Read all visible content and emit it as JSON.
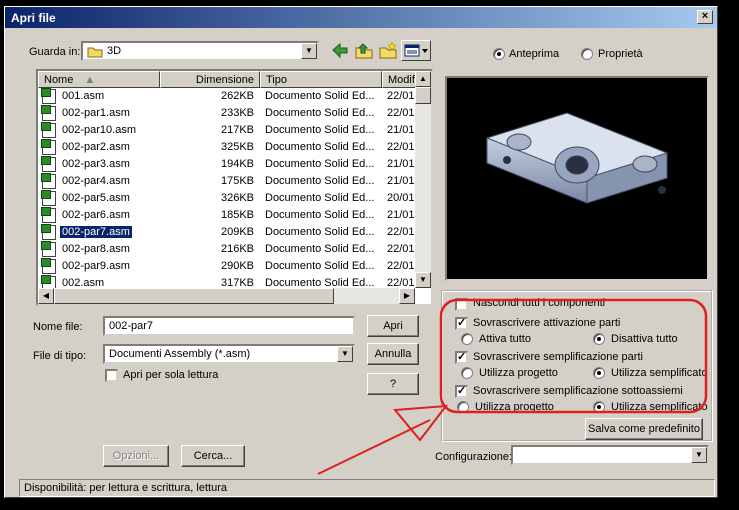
{
  "window": {
    "title": "Apri file",
    "close_glyph": "×"
  },
  "look_in": {
    "label": "Guarda in:",
    "value": "3D"
  },
  "columns": [
    "Nome",
    "Dimensione",
    "Tipo",
    "Modifi"
  ],
  "files": [
    {
      "name": "001.asm",
      "size": "262KB",
      "type": "Documento Solid Ed...",
      "date": "22/01"
    },
    {
      "name": "002-par1.asm",
      "size": "233KB",
      "type": "Documento Solid Ed...",
      "date": "22/01"
    },
    {
      "name": "002-par10.asm",
      "size": "217KB",
      "type": "Documento Solid Ed...",
      "date": "21/01"
    },
    {
      "name": "002-par2.asm",
      "size": "325KB",
      "type": "Documento Solid Ed...",
      "date": "22/01"
    },
    {
      "name": "002-par3.asm",
      "size": "194KB",
      "type": "Documento Solid Ed...",
      "date": "21/01"
    },
    {
      "name": "002-par4.asm",
      "size": "175KB",
      "type": "Documento Solid Ed...",
      "date": "21/01"
    },
    {
      "name": "002-par5.asm",
      "size": "326KB",
      "type": "Documento Solid Ed...",
      "date": "20/01"
    },
    {
      "name": "002-par6.asm",
      "size": "185KB",
      "type": "Documento Solid Ed...",
      "date": "21/01"
    },
    {
      "name": "002-par7.asm",
      "size": "209KB",
      "type": "Documento Solid Ed...",
      "date": "22/01",
      "selected": true
    },
    {
      "name": "002-par8.asm",
      "size": "216KB",
      "type": "Documento Solid Ed...",
      "date": "22/01"
    },
    {
      "name": "002-par9.asm",
      "size": "290KB",
      "type": "Documento Solid Ed...",
      "date": "22/01"
    },
    {
      "name": "002.asm",
      "size": "317KB",
      "type": "Documento Solid Ed...",
      "date": "22/01"
    }
  ],
  "filename": {
    "label": "Nome file:",
    "value": "002-par7"
  },
  "filetype": {
    "label": "File di tipo:",
    "value": "Documenti Assembly (*.asm)"
  },
  "readonly": {
    "label": "Apri per sola lettura",
    "checked": false
  },
  "buttons": {
    "open": "Apri",
    "cancel": "Annulla",
    "help": "?",
    "options": "Opzioni...",
    "search": "Cerca...",
    "save_default": "Salva come predefinito"
  },
  "view_mode": {
    "preview": "Anteprima",
    "properties": "Proprietà",
    "selected": "preview"
  },
  "options": {
    "hide_components": "Nascondi tutti i componenti",
    "activation": {
      "label": "Sovrascrivere attivazione parti",
      "checked": true,
      "opt_a": "Attiva tutto",
      "opt_b": "Disattiva tutto",
      "selected": "b"
    },
    "simplify_parts": {
      "label": "Sovrascrivere semplificazione parti",
      "checked": true,
      "opt_a": "Utilizza progetto",
      "opt_b": "Utilizza semplificato",
      "selected": "b"
    },
    "simplify_subasm": {
      "label": "Sovrascrivere semplificazione sottoassiemi",
      "checked": true,
      "opt_a": "Utilizza progetto",
      "opt_b": "Utilizza semplificato",
      "selected": "b"
    }
  },
  "configuration": {
    "label": "Configurazione:",
    "value": ""
  },
  "status": "Disponibilità: per lettura e scrittura, lettura",
  "colors": {
    "title_start": "#0a246a",
    "title_end": "#a6caf0",
    "annotation": "#e02020",
    "selection": "#0a246a"
  },
  "icons": [
    "folder-icon",
    "back-icon",
    "up-folder-icon",
    "new-folder-icon",
    "view-menu-icon",
    "file-asm-icon"
  ]
}
